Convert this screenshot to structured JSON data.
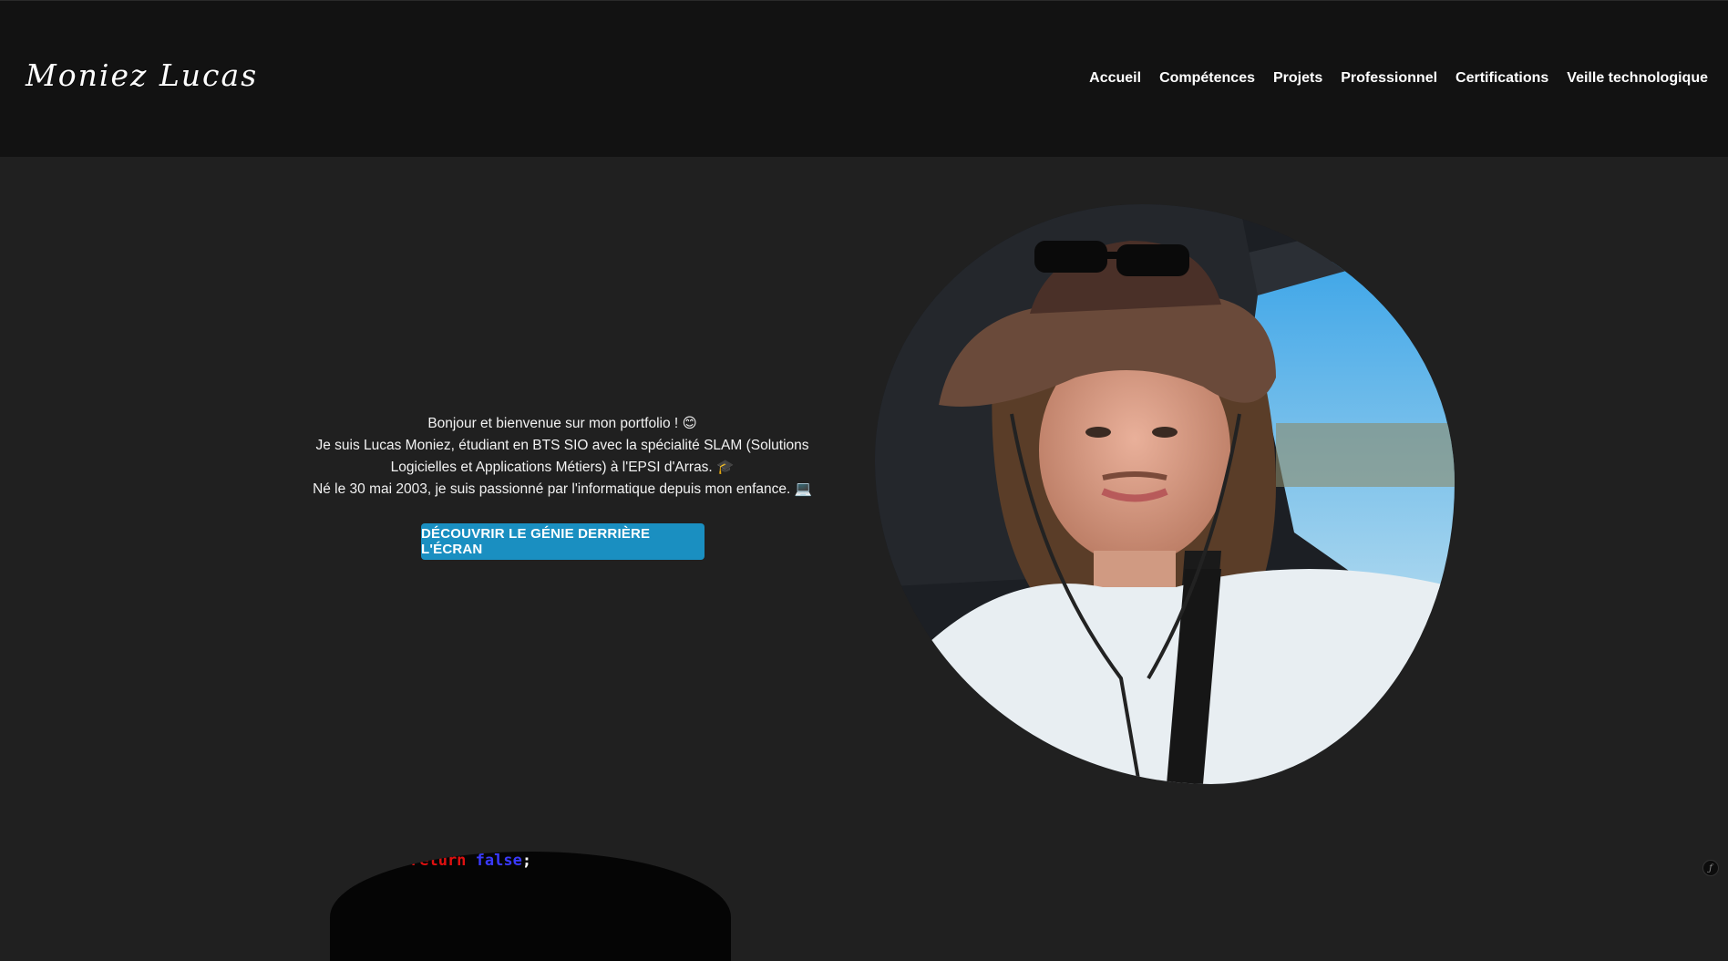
{
  "header": {
    "logo_text": "Moniez Lucas",
    "nav": [
      {
        "label": "Accueil"
      },
      {
        "label": "Compétences"
      },
      {
        "label": "Projets"
      },
      {
        "label": "Professionnel"
      },
      {
        "label": "Certifications"
      },
      {
        "label": "Veille technologique"
      }
    ]
  },
  "hero": {
    "line1": "Bonjour et bienvenue sur mon portfolio ! 😊",
    "line2": "Je suis Lucas Moniez, étudiant en BTS SIO avec la spécialité SLAM (Solutions Logicielles et Applications Métiers) à l'EPSI d'Arras. 🎓",
    "line3": "Né le 30 mai 2003, je suis passionné par l'informatique depuis mon enfance. 💻",
    "cta_label": "DÉCOUVRIR LE GÉNIE DERRIÈRE L'ÉCRAN"
  },
  "code_preview": {
    "keyword_return": "return",
    "keyword_false": "false",
    "semicolon": ";"
  },
  "colors": {
    "page_bg": "#202020",
    "header_bg": "#121212",
    "cta_bg": "#1a8fc1",
    "text": "#ffffff"
  },
  "icons": {
    "corner_badge": "wix-logo-icon"
  }
}
